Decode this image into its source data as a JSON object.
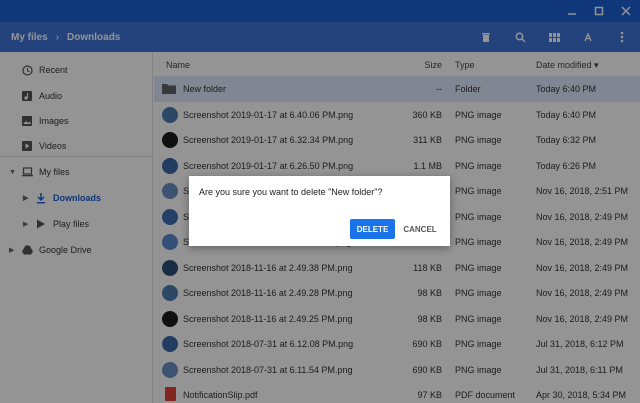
{
  "breadcrumb": {
    "root": "My files",
    "current": "Downloads"
  },
  "toolbar_icons": [
    "delete-icon",
    "search-icon",
    "grid-view-icon",
    "sort-icon",
    "more-vert-icon"
  ],
  "sidebar": {
    "recent": "Recent",
    "audio": "Audio",
    "images": "Images",
    "videos": "Videos",
    "my_files": "My files",
    "downloads": "Downloads",
    "play_files": "Play files",
    "google_drive": "Google Drive"
  },
  "headers": {
    "name": "Name",
    "size": "Size",
    "type": "Type",
    "date": "Date modified"
  },
  "files": [
    {
      "name": "New folder",
      "size": "--",
      "type": "Folder",
      "date": "Today 6:40 PM",
      "icon": "folder-icon"
    },
    {
      "name": "Screenshot 2019-01-17 at 6.40.06 PM.png",
      "size": "360 KB",
      "type": "PNG image",
      "date": "Today 6:40 PM",
      "icon": "image-thumb"
    },
    {
      "name": "Screenshot 2019-01-17 at 6.32.34 PM.png",
      "size": "311 KB",
      "type": "PNG image",
      "date": "Today 6:32 PM",
      "icon": "image-thumb"
    },
    {
      "name": "Screenshot 2019-01-17 at 6.26.50 PM.png",
      "size": "1.1 MB",
      "type": "PNG image",
      "date": "Today 6:26 PM",
      "icon": "image-thumb"
    },
    {
      "name": "Screenshot 2018-11-16 at 2.51.xx PM.png",
      "size": "",
      "type": "PNG image",
      "date": "Nov 16, 2018, 2:51 PM",
      "icon": "image-thumb"
    },
    {
      "name": "Screenshot 2018-11-16 at 2.49.xx PM.png",
      "size": "",
      "type": "PNG image",
      "date": "Nov 16, 2018, 2:49 PM",
      "icon": "image-thumb"
    },
    {
      "name": "Screenshot 2018-11-16 at 2.49.xx PM.png",
      "size": "",
      "type": "PNG image",
      "date": "Nov 16, 2018, 2:49 PM",
      "icon": "image-thumb"
    },
    {
      "name": "Screenshot 2018-11-16 at 2.49.38 PM.png",
      "size": "118 KB",
      "type": "PNG image",
      "date": "Nov 16, 2018, 2:49 PM",
      "icon": "image-thumb"
    },
    {
      "name": "Screenshot 2018-11-16 at 2.49.28 PM.png",
      "size": "98 KB",
      "type": "PNG image",
      "date": "Nov 16, 2018, 2:49 PM",
      "icon": "image-thumb"
    },
    {
      "name": "Screenshot 2018-11-16 at 2.49.25 PM.png",
      "size": "98 KB",
      "type": "PNG image",
      "date": "Nov 16, 2018, 2:49 PM",
      "icon": "image-thumb"
    },
    {
      "name": "Screenshot 2018-07-31 at 6.12.08 PM.png",
      "size": "690 KB",
      "type": "PNG image",
      "date": "Jul 31, 2018, 6:12 PM",
      "icon": "image-thumb"
    },
    {
      "name": "Screenshot 2018-07-31 at 6.11.54 PM.png",
      "size": "690 KB",
      "type": "PNG image",
      "date": "Jul 31, 2018, 6:11 PM",
      "icon": "image-thumb"
    },
    {
      "name": "NotificationSlip.pdf",
      "size": "97 KB",
      "type": "PDF document",
      "date": "Apr 30, 2018, 5:34 PM",
      "icon": "pdf-icon"
    }
  ],
  "dialog": {
    "message": "Are you sure you want to delete \"New folder\"?",
    "delete_label": "DELETE",
    "cancel_label": "CANCEL"
  },
  "colors": {
    "titlebar": "#1a5fd3",
    "toolbar": "#3f74d6",
    "accent": "#1a73e8"
  }
}
